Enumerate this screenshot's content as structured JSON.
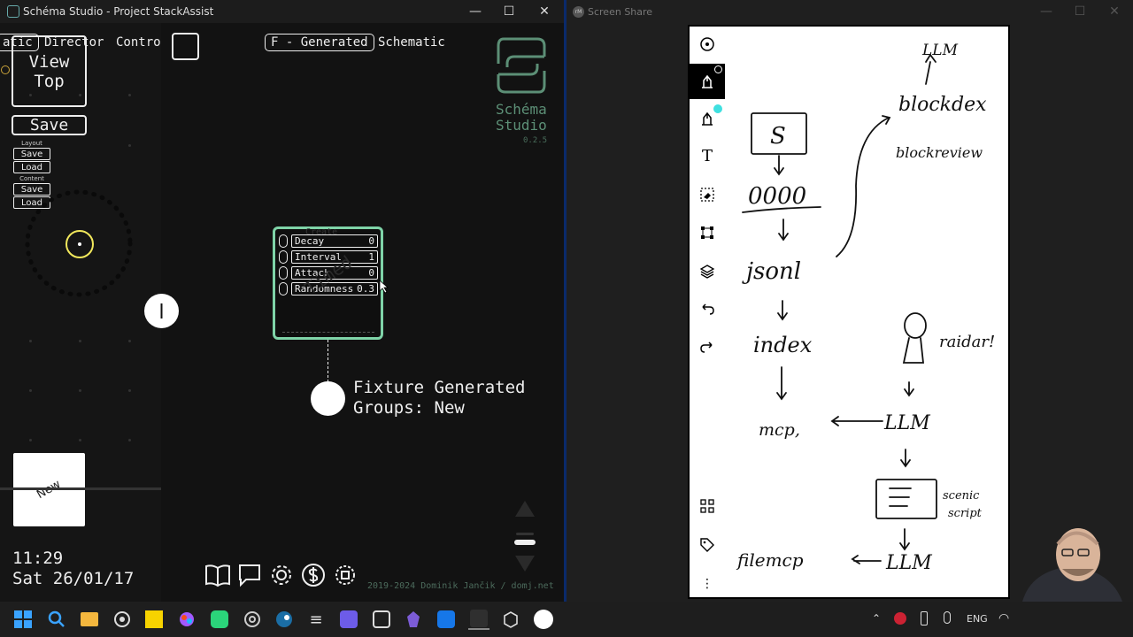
{
  "window1": {
    "title": "Schéma Studio - Project StackAssist",
    "controls": {
      "minimize": "—",
      "maximize": "☐",
      "close": "✕"
    },
    "tabs": {
      "schematic_partial": "atic",
      "director": "Director",
      "control_partial": "Contro",
      "generated": "F - Generated",
      "schematic": "Schematic"
    },
    "left_panel": {
      "view_top": "View\nTop",
      "save": "Save",
      "layout_label": "Layout",
      "layout_save": "Save",
      "layout_load": "Load",
      "content_label": "Content",
      "content_save": "Save",
      "content_load": "Load",
      "new_card": "New",
      "time": "11:29",
      "date": "Sat 26/01/17"
    },
    "logo": {
      "name_line1": "Schéma",
      "name_line2": "Studio",
      "version": "0.2.5"
    },
    "node": {
      "ghost_title": "Create",
      "watermark": "Timed",
      "params": [
        {
          "name": "Decay",
          "value": "0"
        },
        {
          "name": "Interval",
          "value": "1"
        },
        {
          "name": "Attack",
          "value": "0"
        },
        {
          "name": "Randomness",
          "value": "0.3"
        }
      ]
    },
    "fixture": {
      "line1": "Fixture Generated",
      "line2": "Groups: New"
    },
    "footer_credit": "2019-2024 Dominik Jančik / domj.net"
  },
  "window2": {
    "title": "Screen Share",
    "app_icon": "rM",
    "sketch_text": {
      "llm_top": "LLM",
      "blockdex": "blockdex",
      "blockreview": "blockreview",
      "s_box": "S",
      "zeros": "0000",
      "jsonl": "jsonl",
      "index": "index",
      "raidar": "raidar!",
      "mcp": "mcp,",
      "llm_mid": "LLM",
      "scenic": "scenic",
      "script": "script",
      "filemcp": "filemcp",
      "llm_bottom": "LLM"
    }
  },
  "taskbar": {
    "lang": "ENG",
    "icons": [
      "windows-start-icon",
      "search-icon",
      "file-explorer-icon",
      "obs-icon",
      "sticky-notes-icon",
      "figma-icon",
      "sync-icon",
      "chromium-icon",
      "steam-icon",
      "menu-icon",
      "notes-app-icon",
      "terminal-icon",
      "obsidian-icon",
      "editor-icon",
      "active-window-icon",
      "box-icon",
      "remarkable-icon"
    ]
  },
  "colors": {
    "accent_green": "#7fd4a8",
    "logo_green": "#5c8f76",
    "highlight_yellow": "#f2e85c"
  }
}
